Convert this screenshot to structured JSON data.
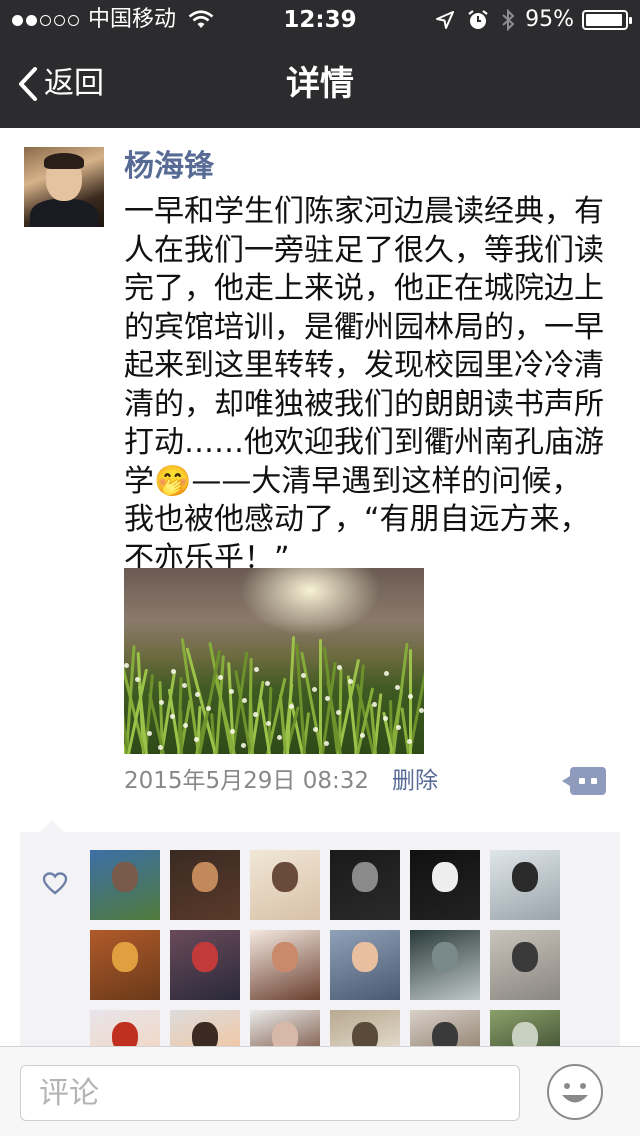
{
  "status_bar": {
    "carrier": "中国移动",
    "time": "12:39",
    "battery": "95%",
    "battery_level": 0.95,
    "signal_bars": 2,
    "icons": [
      "wifi-icon",
      "location-icon",
      "alarm-icon",
      "bluetooth-icon",
      "battery-icon"
    ]
  },
  "nav": {
    "back_label": "返回",
    "title": "详情"
  },
  "post": {
    "author": "杨海锋",
    "text": "一早和学生们陈家河边晨读经典，有人在我们一旁驻足了很久，等我们读完了，他走上来说，他正在城院边上的宾馆培训，是衢州园林局的，一早起来到这里转转，发现校园里冷冷清清的，却唯独被我们的朗朗读书声所打动……他欢迎我们到衢州南孔庙游学🤭——大清早遇到这样的问候，我也被他感动了，“有朋自远方来，不亦乐乎！”",
    "timestamp": "2015年5月29日 08:32",
    "delete_label": "删除"
  },
  "likes": {
    "icon": "heart-icon",
    "count_visible": 18
  },
  "comment": {
    "placeholder": "评论"
  },
  "colors": {
    "nav_bg": "#2c2c2e",
    "link": "#576b95",
    "likes_bg": "#f3f3f5"
  }
}
